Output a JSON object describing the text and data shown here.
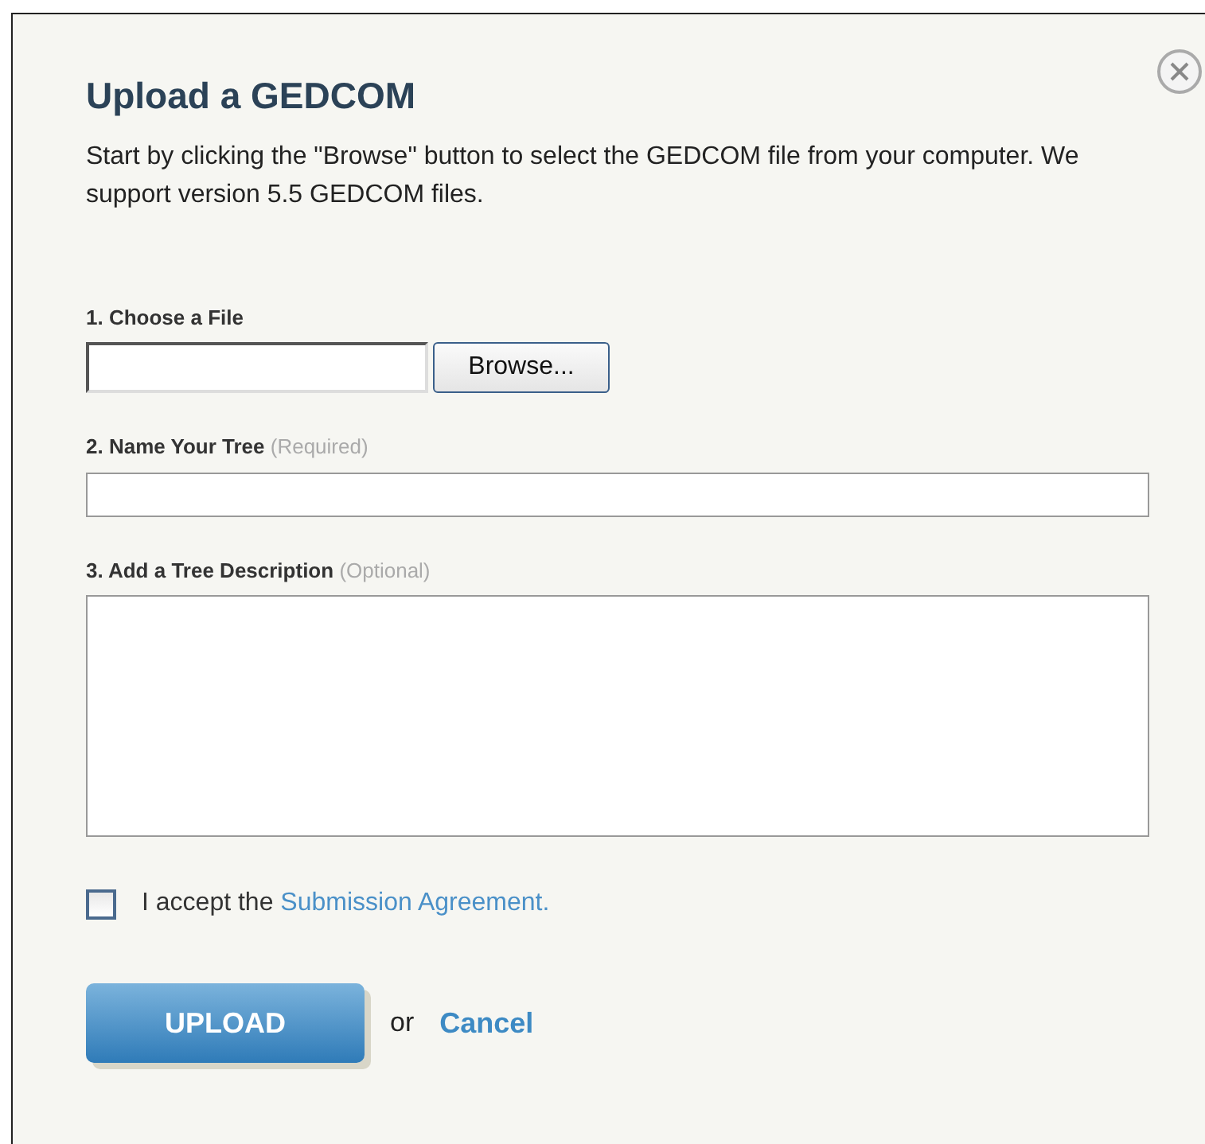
{
  "dialog": {
    "title": "Upload a GEDCOM",
    "intro": "Start by clicking the \"Browse\" button to select the GEDCOM file from your computer. We support version 5.5 GEDCOM files.",
    "file": {
      "label": "1. Choose a File",
      "button": "Browse..."
    },
    "name": {
      "label": "2. Name Your Tree",
      "hint": "(Required)"
    },
    "description": {
      "label": "3. Add a Tree Description",
      "hint": "(Optional)"
    },
    "agreement": {
      "checked": false,
      "text": "I accept the ",
      "link": "Submission Agreement."
    },
    "upload": "UPLOAD",
    "or": "or",
    "cancel": "Cancel"
  }
}
